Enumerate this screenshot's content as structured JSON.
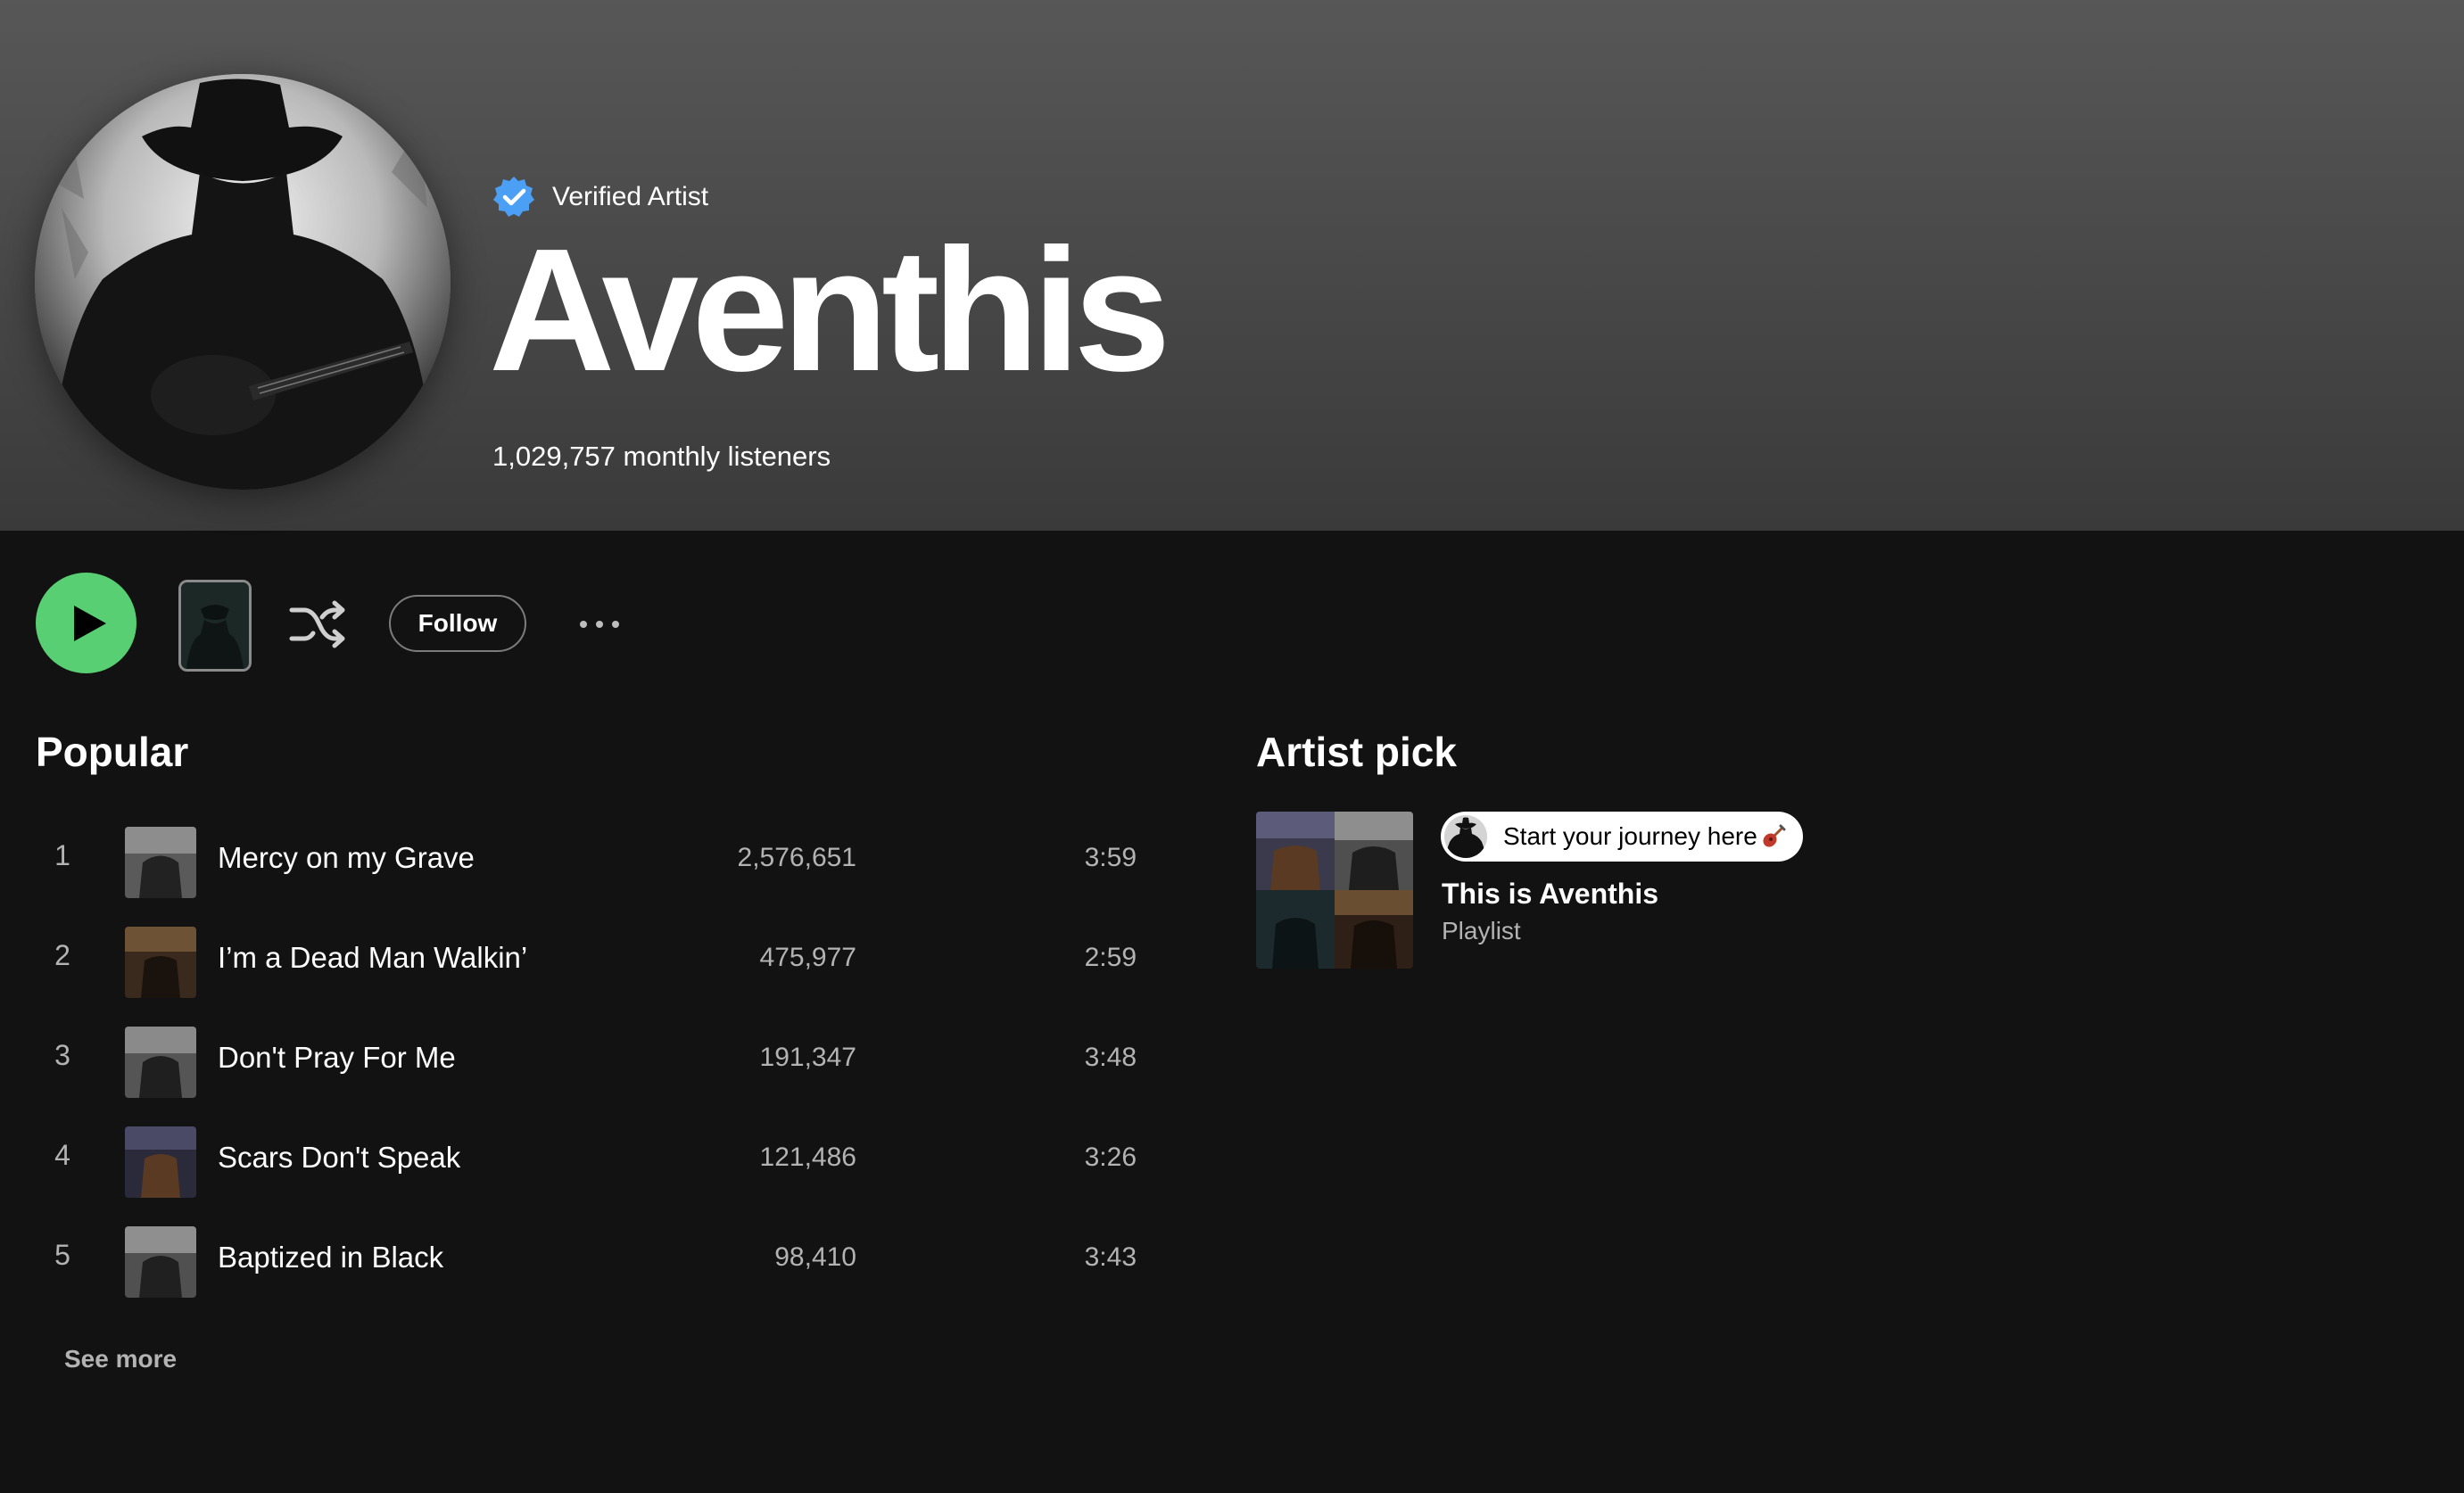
{
  "artist": {
    "verified_label": "Verified Artist",
    "name": "Aventhis",
    "monthly_listeners": "1,029,757 monthly listeners"
  },
  "actions": {
    "follow_label": "Follow"
  },
  "popular": {
    "title": "Popular",
    "tracks": [
      {
        "number": "1",
        "title": "Mercy on my Grave",
        "plays": "2,576,651",
        "duration": "3:59"
      },
      {
        "number": "2",
        "title": "I’m a Dead Man Walkin’",
        "plays": "475,977",
        "duration": "2:59"
      },
      {
        "number": "3",
        "title": "Don't Pray For Me",
        "plays": "191,347",
        "duration": "3:48"
      },
      {
        "number": "4",
        "title": "Scars Don't Speak",
        "plays": "121,486",
        "duration": "3:26"
      },
      {
        "number": "5",
        "title": "Baptized in Black",
        "plays": "98,410",
        "duration": "3:43"
      }
    ],
    "see_more_label": "See more"
  },
  "artist_pick": {
    "title": "Artist pick",
    "badge_text": "Start your journey here",
    "playlist_title": "This is Aventhis",
    "playlist_type": "Playlist"
  },
  "colors": {
    "accent_green": "#58cf72",
    "verified_blue": "#4ba0f5",
    "background": "#121212",
    "secondary_text": "#b3b3b3"
  },
  "icons": {
    "verified": "verified-badge-icon",
    "play": "play-icon",
    "shuffle": "shuffle-icon",
    "more": "more-options-icon",
    "guitar": "guitar-icon"
  }
}
